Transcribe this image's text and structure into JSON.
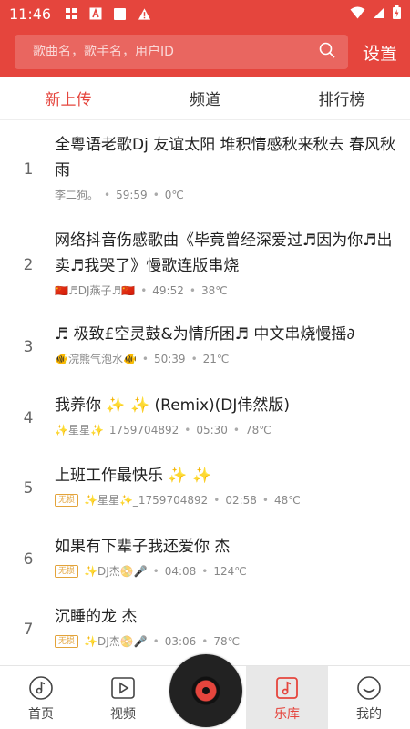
{
  "status_bar": {
    "time": "11:46"
  },
  "search": {
    "placeholder": "歌曲名，歌手名，用户ID",
    "settings_label": "设置"
  },
  "tabs": [
    {
      "label": "新上传"
    },
    {
      "label": "频道"
    },
    {
      "label": "排行榜"
    }
  ],
  "songs": [
    {
      "index": "1",
      "title": "全粤语老歌Dj 友谊太阳 堆积情感秋来秋去 春风秋雨",
      "badge": "",
      "uploader": "李二狗。",
      "duration": "59:59",
      "temp": "0℃"
    },
    {
      "index": "2",
      "title": "网络抖音伤感歌曲《毕竟曾经深爱过♬因为你♬出卖♬我哭了》慢歌连版串烧",
      "badge": "",
      "uploader": "🇨🇳♬DJ燕子♬🇨🇳",
      "duration": "49:52",
      "temp": "38℃"
    },
    {
      "index": "3",
      "title": "♬ 极致£空灵鼓&为情所困♬ 中文串烧慢摇∂",
      "badge": "",
      "uploader": "🐠浣熊气泡水🐠",
      "duration": "50:39",
      "temp": "21℃"
    },
    {
      "index": "4",
      "title": "我养你 ✨ ✨ (Remix)(DJ伟然版)",
      "badge": "",
      "uploader": "✨星星✨_1759704892",
      "duration": "05:30",
      "temp": "78℃"
    },
    {
      "index": "5",
      "title": "上班工作最快乐 ✨ ✨",
      "badge": "无损",
      "uploader": "✨星星✨_1759704892",
      "duration": "02:58",
      "temp": "48℃"
    },
    {
      "index": "6",
      "title": "如果有下辈子我还爱你  杰",
      "badge": "无损",
      "uploader": "✨DJ杰📀🎤",
      "duration": "04:08",
      "temp": "124℃"
    },
    {
      "index": "7",
      "title": "沉睡的龙  杰",
      "badge": "无损",
      "uploader": "✨DJ杰📀🎤",
      "duration": "03:06",
      "temp": "78℃"
    }
  ],
  "bottom_nav": [
    {
      "label": "首页",
      "icon": "home-note-icon"
    },
    {
      "label": "视频",
      "icon": "video-play-icon"
    },
    {
      "label": "乐库",
      "icon": "library-note-icon"
    },
    {
      "label": "我的",
      "icon": "profile-face-icon"
    }
  ],
  "colors": {
    "accent": "#e5453d",
    "badge": "#e3a33a"
  }
}
